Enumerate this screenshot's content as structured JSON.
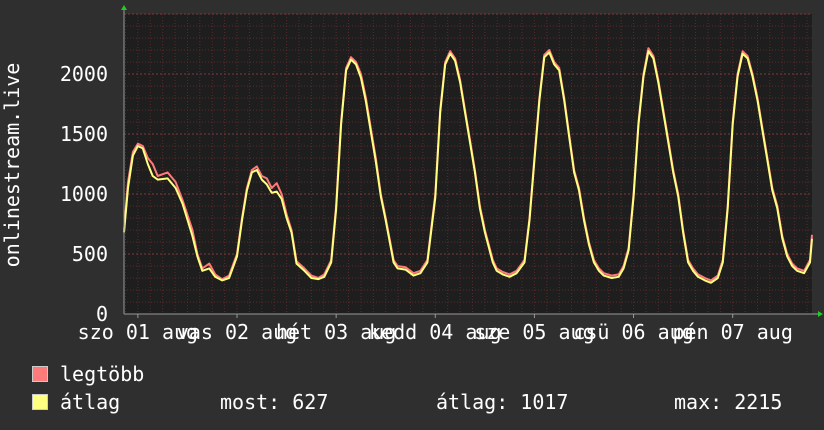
{
  "chart_data": {
    "type": "line",
    "ylabel": "onlinestream.live",
    "ylim": [
      0,
      2500
    ],
    "yticks": [
      0,
      500,
      1000,
      1500,
      2000
    ],
    "ytick_labels": [
      "0",
      "500",
      "1000",
      "1500",
      "2000"
    ],
    "xticks": [
      {
        "label": "szo 01 aug",
        "day": 0
      },
      {
        "label": "vas 02 aug",
        "day": 1
      },
      {
        "label": "hét 03 aug",
        "day": 2
      },
      {
        "label": "kedd 04 aug",
        "day": 3
      },
      {
        "label": "sze 05 aug",
        "day": 4
      },
      {
        "label": "csü 06 aug",
        "day": 5
      },
      {
        "label": "pén 07 aug",
        "day": 6
      }
    ],
    "xlim_days": [
      -0.14,
      6.8
    ],
    "grid": true,
    "colors": {
      "max": "#ff7a7a",
      "avg": "#ffff80",
      "plot_bg": "#1e1e1e",
      "grid": "#5a2a2a",
      "axis": "#9a9a9a"
    },
    "series": [
      {
        "name": "legtöbb",
        "color": "#ff7a7a",
        "points": [
          [
            -0.14,
            700
          ],
          [
            -0.1,
            1100
          ],
          [
            -0.05,
            1350
          ],
          [
            0,
            1420
          ],
          [
            0.05,
            1400
          ],
          [
            0.1,
            1300
          ],
          [
            0.15,
            1250
          ],
          [
            0.2,
            1150
          ],
          [
            0.3,
            1180
          ],
          [
            0.38,
            1100
          ],
          [
            0.45,
            950
          ],
          [
            0.55,
            700
          ],
          [
            0.6,
            500
          ],
          [
            0.65,
            380
          ],
          [
            0.72,
            420
          ],
          [
            0.78,
            330
          ],
          [
            0.85,
            290
          ],
          [
            0.92,
            320
          ],
          [
            1.0,
            500
          ],
          [
            1.05,
            800
          ],
          [
            1.1,
            1050
          ],
          [
            1.15,
            1200
          ],
          [
            1.2,
            1230
          ],
          [
            1.25,
            1150
          ],
          [
            1.3,
            1130
          ],
          [
            1.35,
            1050
          ],
          [
            1.4,
            1090
          ],
          [
            1.45,
            1000
          ],
          [
            1.5,
            830
          ],
          [
            1.55,
            700
          ],
          [
            1.6,
            440
          ],
          [
            1.68,
            380
          ],
          [
            1.75,
            320
          ],
          [
            1.82,
            300
          ],
          [
            1.88,
            330
          ],
          [
            1.95,
            450
          ],
          [
            2.0,
            900
          ],
          [
            2.05,
            1600
          ],
          [
            2.1,
            2050
          ],
          [
            2.15,
            2140
          ],
          [
            2.2,
            2100
          ],
          [
            2.25,
            2000
          ],
          [
            2.3,
            1800
          ],
          [
            2.35,
            1550
          ],
          [
            2.4,
            1300
          ],
          [
            2.45,
            1000
          ],
          [
            2.5,
            800
          ],
          [
            2.58,
            450
          ],
          [
            2.62,
            400
          ],
          [
            2.7,
            390
          ],
          [
            2.78,
            340
          ],
          [
            2.85,
            360
          ],
          [
            2.92,
            450
          ],
          [
            3.0,
            1000
          ],
          [
            3.05,
            1700
          ],
          [
            3.1,
            2100
          ],
          [
            3.15,
            2190
          ],
          [
            3.2,
            2130
          ],
          [
            3.25,
            1950
          ],
          [
            3.3,
            1700
          ],
          [
            3.35,
            1450
          ],
          [
            3.4,
            1200
          ],
          [
            3.45,
            900
          ],
          [
            3.5,
            700
          ],
          [
            3.58,
            450
          ],
          [
            3.62,
            380
          ],
          [
            3.68,
            350
          ],
          [
            3.75,
            330
          ],
          [
            3.82,
            360
          ],
          [
            3.9,
            450
          ],
          [
            3.95,
            800
          ],
          [
            4.0,
            1300
          ],
          [
            4.05,
            1800
          ],
          [
            4.1,
            2160
          ],
          [
            4.15,
            2200
          ],
          [
            4.2,
            2100
          ],
          [
            4.25,
            2050
          ],
          [
            4.3,
            1800
          ],
          [
            4.35,
            1500
          ],
          [
            4.4,
            1200
          ],
          [
            4.45,
            1050
          ],
          [
            4.5,
            800
          ],
          [
            4.55,
            600
          ],
          [
            4.6,
            450
          ],
          [
            4.65,
            380
          ],
          [
            4.7,
            340
          ],
          [
            4.78,
            320
          ],
          [
            4.85,
            330
          ],
          [
            4.9,
            400
          ],
          [
            4.95,
            550
          ],
          [
            5.0,
            1000
          ],
          [
            5.05,
            1600
          ],
          [
            5.1,
            2000
          ],
          [
            5.15,
            2215
          ],
          [
            5.2,
            2150
          ],
          [
            5.25,
            1950
          ],
          [
            5.3,
            1700
          ],
          [
            5.35,
            1450
          ],
          [
            5.4,
            1200
          ],
          [
            5.45,
            1000
          ],
          [
            5.5,
            700
          ],
          [
            5.55,
            450
          ],
          [
            5.6,
            380
          ],
          [
            5.65,
            330
          ],
          [
            5.72,
            300
          ],
          [
            5.78,
            280
          ],
          [
            5.85,
            320
          ],
          [
            5.9,
            450
          ],
          [
            5.95,
            900
          ],
          [
            6.0,
            1600
          ],
          [
            6.05,
            2000
          ],
          [
            6.1,
            2190
          ],
          [
            6.15,
            2150
          ],
          [
            6.2,
            2000
          ],
          [
            6.25,
            1800
          ],
          [
            6.3,
            1550
          ],
          [
            6.35,
            1300
          ],
          [
            6.4,
            1050
          ],
          [
            6.45,
            900
          ],
          [
            6.5,
            650
          ],
          [
            6.55,
            500
          ],
          [
            6.6,
            420
          ],
          [
            6.65,
            380
          ],
          [
            6.72,
            360
          ],
          [
            6.78,
            450
          ],
          [
            6.8,
            660
          ]
        ]
      },
      {
        "name": "átlag",
        "color": "#ffff80",
        "points": [
          [
            -0.14,
            680
          ],
          [
            -0.1,
            1050
          ],
          [
            -0.05,
            1320
          ],
          [
            0,
            1400
          ],
          [
            0.05,
            1380
          ],
          [
            0.1,
            1250
          ],
          [
            0.15,
            1150
          ],
          [
            0.2,
            1120
          ],
          [
            0.3,
            1130
          ],
          [
            0.38,
            1050
          ],
          [
            0.45,
            920
          ],
          [
            0.55,
            650
          ],
          [
            0.6,
            480
          ],
          [
            0.65,
            360
          ],
          [
            0.72,
            380
          ],
          [
            0.78,
            310
          ],
          [
            0.85,
            280
          ],
          [
            0.92,
            300
          ],
          [
            1.0,
            480
          ],
          [
            1.05,
            780
          ],
          [
            1.1,
            1030
          ],
          [
            1.15,
            1180
          ],
          [
            1.2,
            1200
          ],
          [
            1.25,
            1120
          ],
          [
            1.3,
            1080
          ],
          [
            1.35,
            1010
          ],
          [
            1.4,
            1020
          ],
          [
            1.45,
            960
          ],
          [
            1.5,
            800
          ],
          [
            1.55,
            680
          ],
          [
            1.6,
            420
          ],
          [
            1.68,
            360
          ],
          [
            1.75,
            300
          ],
          [
            1.82,
            290
          ],
          [
            1.88,
            310
          ],
          [
            1.95,
            430
          ],
          [
            2.0,
            870
          ],
          [
            2.05,
            1580
          ],
          [
            2.1,
            2030
          ],
          [
            2.15,
            2120
          ],
          [
            2.2,
            2080
          ],
          [
            2.25,
            1970
          ],
          [
            2.3,
            1770
          ],
          [
            2.35,
            1520
          ],
          [
            2.4,
            1270
          ],
          [
            2.45,
            980
          ],
          [
            2.5,
            780
          ],
          [
            2.58,
            430
          ],
          [
            2.62,
            380
          ],
          [
            2.7,
            370
          ],
          [
            2.78,
            320
          ],
          [
            2.85,
            340
          ],
          [
            2.92,
            430
          ],
          [
            3.0,
            970
          ],
          [
            3.05,
            1680
          ],
          [
            3.1,
            2080
          ],
          [
            3.15,
            2170
          ],
          [
            3.2,
            2110
          ],
          [
            3.25,
            1930
          ],
          [
            3.3,
            1680
          ],
          [
            3.35,
            1430
          ],
          [
            3.4,
            1180
          ],
          [
            3.45,
            880
          ],
          [
            3.5,
            680
          ],
          [
            3.58,
            430
          ],
          [
            3.62,
            360
          ],
          [
            3.68,
            330
          ],
          [
            3.75,
            310
          ],
          [
            3.82,
            340
          ],
          [
            3.9,
            430
          ],
          [
            3.95,
            780
          ],
          [
            4.0,
            1280
          ],
          [
            4.05,
            1780
          ],
          [
            4.1,
            2140
          ],
          [
            4.15,
            2180
          ],
          [
            4.2,
            2080
          ],
          [
            4.25,
            2030
          ],
          [
            4.3,
            1780
          ],
          [
            4.35,
            1480
          ],
          [
            4.4,
            1180
          ],
          [
            4.45,
            1030
          ],
          [
            4.5,
            780
          ],
          [
            4.55,
            580
          ],
          [
            4.6,
            430
          ],
          [
            4.65,
            360
          ],
          [
            4.7,
            320
          ],
          [
            4.78,
            300
          ],
          [
            4.85,
            310
          ],
          [
            4.9,
            380
          ],
          [
            4.95,
            530
          ],
          [
            5.0,
            980
          ],
          [
            5.05,
            1580
          ],
          [
            5.1,
            1980
          ],
          [
            5.15,
            2190
          ],
          [
            5.2,
            2130
          ],
          [
            5.25,
            1930
          ],
          [
            5.3,
            1680
          ],
          [
            5.35,
            1430
          ],
          [
            5.4,
            1180
          ],
          [
            5.45,
            980
          ],
          [
            5.5,
            680
          ],
          [
            5.55,
            430
          ],
          [
            5.6,
            360
          ],
          [
            5.65,
            310
          ],
          [
            5.72,
            280
          ],
          [
            5.78,
            260
          ],
          [
            5.85,
            300
          ],
          [
            5.9,
            430
          ],
          [
            5.95,
            880
          ],
          [
            6.0,
            1580
          ],
          [
            6.05,
            1980
          ],
          [
            6.1,
            2170
          ],
          [
            6.15,
            2130
          ],
          [
            6.2,
            1980
          ],
          [
            6.25,
            1780
          ],
          [
            6.3,
            1530
          ],
          [
            6.35,
            1280
          ],
          [
            6.4,
            1030
          ],
          [
            6.45,
            880
          ],
          [
            6.5,
            630
          ],
          [
            6.55,
            480
          ],
          [
            6.6,
            400
          ],
          [
            6.65,
            360
          ],
          [
            6.72,
            340
          ],
          [
            6.78,
            430
          ],
          [
            6.8,
            627
          ]
        ]
      }
    ]
  },
  "legend": {
    "max_label": "legtöbb",
    "avg_label": "átlag"
  },
  "stats": {
    "now": "most: 627",
    "avg": "átlag: 1017",
    "max": "max: 2215"
  }
}
